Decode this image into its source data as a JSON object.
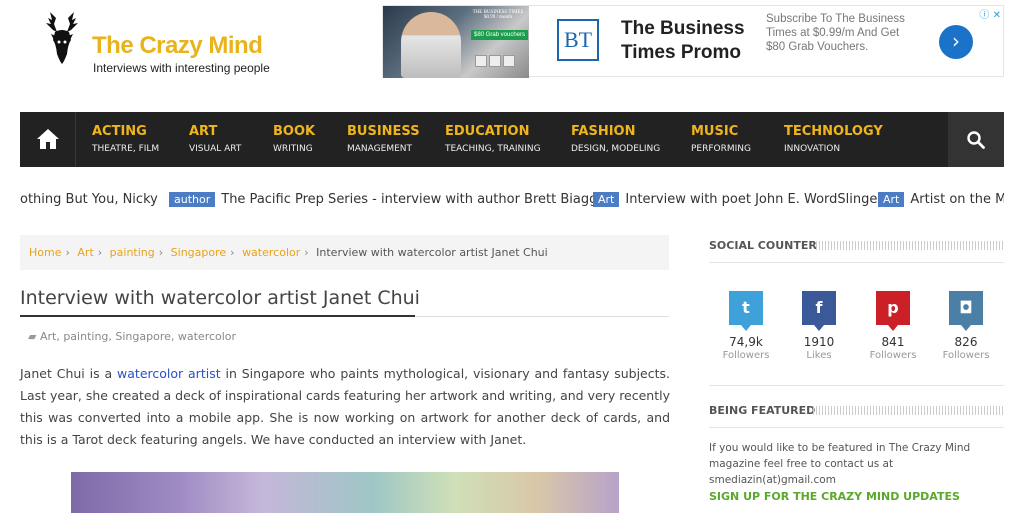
{
  "logo": {
    "title": "The Crazy Mind",
    "tagline": "Interviews with interesting people"
  },
  "ad": {
    "brand_mark": "BT",
    "title": "The Business Times Promo",
    "description": "Subscribe To The Business Times at $0.99/m And Get $80 Grab Vouchers.",
    "image_header": "THE BUSINESS TIMES",
    "image_price": "$0.99 / month",
    "image_promo": "$80 Grab vouchers",
    "choices_icon": "info-icon",
    "close_icon": "close-icon"
  },
  "nav": {
    "items": [
      {
        "title": "ACTING",
        "sub": "THEATRE, FILM"
      },
      {
        "title": "ART",
        "sub": "VISUAL ART"
      },
      {
        "title": "BOOK",
        "sub": "WRITING"
      },
      {
        "title": "BUSINESS",
        "sub": "MANAGEMENT"
      },
      {
        "title": "EDUCATION",
        "sub": "TEACHING, TRAINING"
      },
      {
        "title": "FASHION",
        "sub": "DESIGN, MODELING"
      },
      {
        "title": "MUSIC",
        "sub": "PERFORMING"
      },
      {
        "title": "TECHNOLOGY",
        "sub": "INNOVATION"
      }
    ]
  },
  "ticker": {
    "items": [
      {
        "badge": "",
        "text": "othing But You, Nicky"
      },
      {
        "badge": "author",
        "text": "The Pacific Prep Series - interview with author Brett Biaggio"
      },
      {
        "badge": "Art",
        "text": "Interview with poet John E. WordSlinger"
      },
      {
        "badge": "Art",
        "text": "Artist on the Mo"
      }
    ]
  },
  "breadcrumb": {
    "items": [
      "Home",
      "Art",
      "painting",
      "Singapore",
      "watercolor"
    ],
    "current": "Interview with watercolor artist Janet Chui"
  },
  "article": {
    "title": "Interview with watercolor artist Janet Chui",
    "categories": "Art, painting, Singapore, watercolor",
    "p_start": "Janet Chui is a ",
    "p_link": "watercolor artist",
    "p_end": " in Singapore who paints mythological, visionary and fantasy subjects. Last year, she created a deck of inspirational cards featuring her artwork and writing, and very recently this was converted into a mobile app. She is now working on artwork for another deck of cards, and this is a Tarot deck featuring angels. We have conducted an interview with Janet."
  },
  "sidebar": {
    "social_heading": "SOCIAL COUNTER",
    "social": [
      {
        "icon": "twitter-icon",
        "glyph": "t",
        "count": "74,9k",
        "label": "Followers",
        "color": "#3fa1da"
      },
      {
        "icon": "facebook-icon",
        "glyph": "f",
        "count": "1910",
        "label": "Likes",
        "color": "#3b5998"
      },
      {
        "icon": "pinterest-icon",
        "glyph": "p",
        "count": "841",
        "label": "Followers",
        "color": "#cb2027"
      },
      {
        "icon": "instagram-icon",
        "glyph": "◘",
        "count": "826",
        "label": "Followers",
        "color": "#4c7fa6"
      }
    ],
    "featured_heading": "BEING FEATURED",
    "featured_text": "If you would like to be featured in The Crazy Mind magazine feel free to contact us at smediazin(at)gmail.com",
    "signup_heading": "SIGN UP FOR THE CRAZY MIND UPDATES"
  }
}
